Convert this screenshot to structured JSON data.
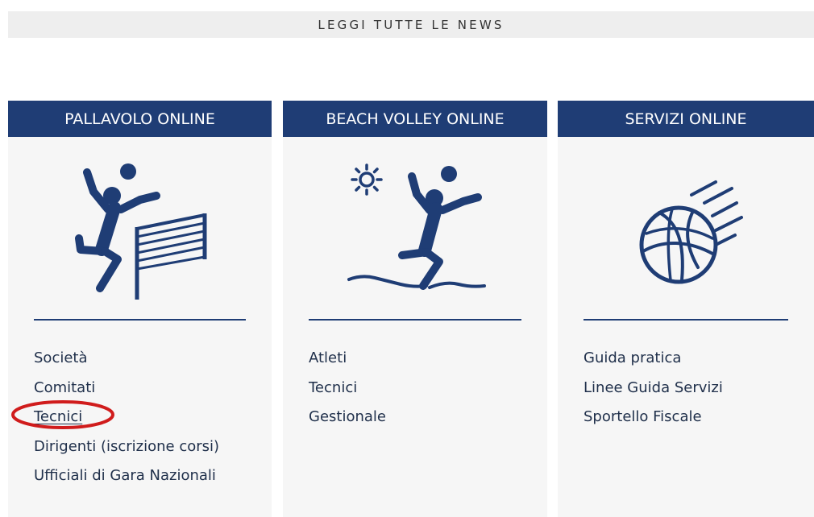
{
  "news": {
    "label": "LEGGI TUTTE LE NEWS"
  },
  "colors": {
    "header_bg": "#1f3d75",
    "column_bg": "#f6f6f6",
    "link_text": "#1f2f4a",
    "annotation": "#d01c1c"
  },
  "columns": [
    {
      "title": "PALLAVOLO ONLINE",
      "icon": "volleyball-player-net-icon",
      "links": [
        "Società",
        "Comitati",
        "Tecnici",
        "Dirigenti (iscrizione corsi)",
        "Ufficiali di Gara Nazionali"
      ]
    },
    {
      "title": "BEACH VOLLEY ONLINE",
      "icon": "beach-volley-player-sun-icon",
      "links": [
        "Atleti",
        "Tecnici",
        "Gestionale"
      ]
    },
    {
      "title": "SERVIZI ONLINE",
      "icon": "volleyball-ball-icon",
      "links": [
        "Guida pratica",
        "Linee Guida Servizi",
        "Sportello Fiscale"
      ]
    }
  ],
  "highlight": {
    "column": "PALLAVOLO ONLINE",
    "link": "Tecnici",
    "style": "red-ellipse-annotation"
  }
}
